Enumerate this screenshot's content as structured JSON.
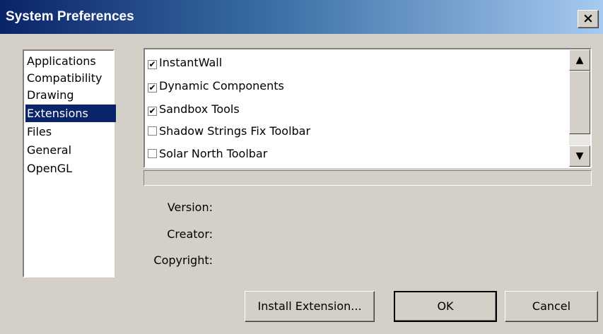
{
  "window": {
    "title": "System Preferences",
    "close_glyph": "×"
  },
  "categories": [
    {
      "label": "Applications"
    },
    {
      "label": "Compatibility"
    },
    {
      "label": "Drawing"
    },
    {
      "label": "Extensions",
      "selected": true
    },
    {
      "label": "Files"
    },
    {
      "label": "General"
    },
    {
      "label": "OpenGL"
    }
  ],
  "extensions": [
    {
      "label": "InstantWall",
      "checked": true
    },
    {
      "label": "Dynamic Components",
      "checked": true
    },
    {
      "label": "Sandbox Tools",
      "checked": true
    },
    {
      "label": "Shadow Strings Fix Toolbar",
      "checked": false
    },
    {
      "label": "Solar North Toolbar",
      "checked": false
    }
  ],
  "details": {
    "version_label": "Version:",
    "creator_label": "Creator:",
    "copyright_label": "Copyright:"
  },
  "buttons": {
    "install": "Install Extension...",
    "ok": "OK",
    "cancel": "Cancel"
  },
  "scroll": {
    "up_glyph": "▲",
    "down_glyph": "▼"
  },
  "colors": {
    "title_bar_start": "#0a246a",
    "title_bar_end": "#a6caf0",
    "selection": "#0a246a",
    "dialog_face": "#d4d0c8"
  }
}
